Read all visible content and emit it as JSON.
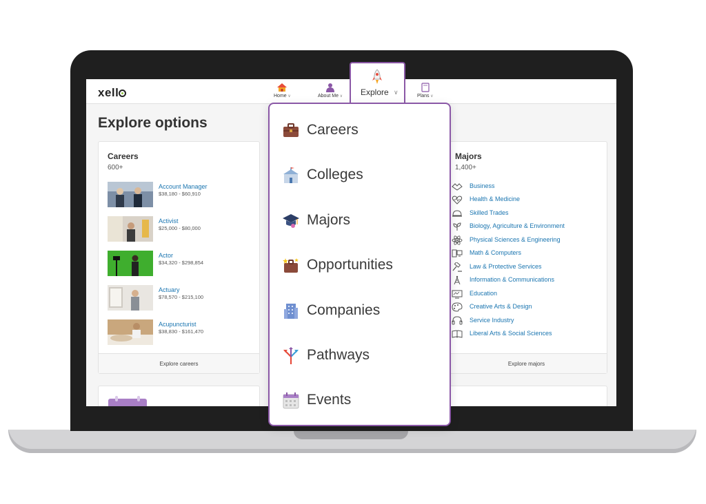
{
  "brand": {
    "logo_prefix": "xell",
    "logo_suffix": ""
  },
  "nav": {
    "home": "Home",
    "about": "About Me",
    "explore": "Explore",
    "plans": "Plans"
  },
  "page": {
    "title": "Explore options"
  },
  "careers": {
    "title": "Careers",
    "count": "600+",
    "items": [
      {
        "name": "Account Manager",
        "salary": "$38,180 - $60,910"
      },
      {
        "name": "Activist",
        "salary": "$25,000 - $80,000"
      },
      {
        "name": "Actor",
        "salary": "$34,320 - $298,854"
      },
      {
        "name": "Actuary",
        "salary": "$78,570 - $215,100"
      },
      {
        "name": "Acupuncturist",
        "salary": "$38,830 - $161,470"
      }
    ],
    "footer": "Explore careers"
  },
  "majors": {
    "title": "Majors",
    "count": "1,400+",
    "items": [
      {
        "name": "Business",
        "icon": "handshake-icon"
      },
      {
        "name": "Health & Medicine",
        "icon": "heartbeat-icon"
      },
      {
        "name": "Skilled Trades",
        "icon": "hardhat-icon"
      },
      {
        "name": "Biology, Agriculture & Environment",
        "icon": "plant-icon"
      },
      {
        "name": "Physical Sciences & Engineering",
        "icon": "atom-icon"
      },
      {
        "name": "Math & Computers",
        "icon": "computer-icon"
      },
      {
        "name": "Law & Protective Services",
        "icon": "gavel-icon"
      },
      {
        "name": "Information & Communications",
        "icon": "antenna-icon"
      },
      {
        "name": "Education",
        "icon": "chalkboard-icon"
      },
      {
        "name": "Creative Arts & Design",
        "icon": "palette-icon"
      },
      {
        "name": "Service Industry",
        "icon": "headset-icon"
      },
      {
        "name": "Liberal Arts & Social Sciences",
        "icon": "book-icon"
      }
    ],
    "footer": "Explore majors"
  },
  "dropdown": {
    "items": [
      {
        "label": "Careers",
        "icon": "briefcase-icon"
      },
      {
        "label": "Colleges",
        "icon": "college-icon"
      },
      {
        "label": "Majors",
        "icon": "graduation-cap-icon"
      },
      {
        "label": "Opportunities",
        "icon": "opportunity-briefcase-icon"
      },
      {
        "label": "Companies",
        "icon": "building-icon"
      },
      {
        "label": "Pathways",
        "icon": "pathways-icon"
      },
      {
        "label": "Events",
        "icon": "calendar-icon"
      }
    ]
  },
  "colors": {
    "accent_purple": "#8a57a6",
    "link_blue": "#1a75b0",
    "bezel": "#1f1f1f"
  }
}
